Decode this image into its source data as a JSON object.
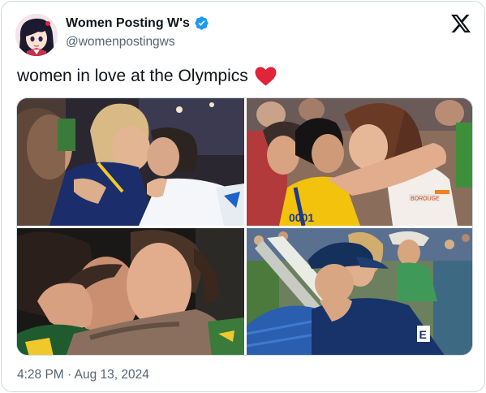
{
  "author": {
    "display_name": "Women Posting W's",
    "handle": "@womenpostingws",
    "verified_icon": "verified-badge-icon",
    "avatar_icon": "anime-avatar"
  },
  "platform_icon": "x-logo-icon",
  "tweet": {
    "text": "women in love at the Olympics",
    "emoji": "red-heart-emoji"
  },
  "media": {
    "photo_1_jersey": "",
    "photo_2_jersey": "0001",
    "photo_2_patch": "BOROUGE",
    "photo_4_logo": "E"
  },
  "timestamp": "4:28 PM · Aug 13, 2024",
  "colors": {
    "text_primary": "#0f1419",
    "text_secondary": "#536471",
    "verified_blue": "#1d9bf0",
    "heart_red": "#e0243a",
    "border": "#cfd9de"
  }
}
